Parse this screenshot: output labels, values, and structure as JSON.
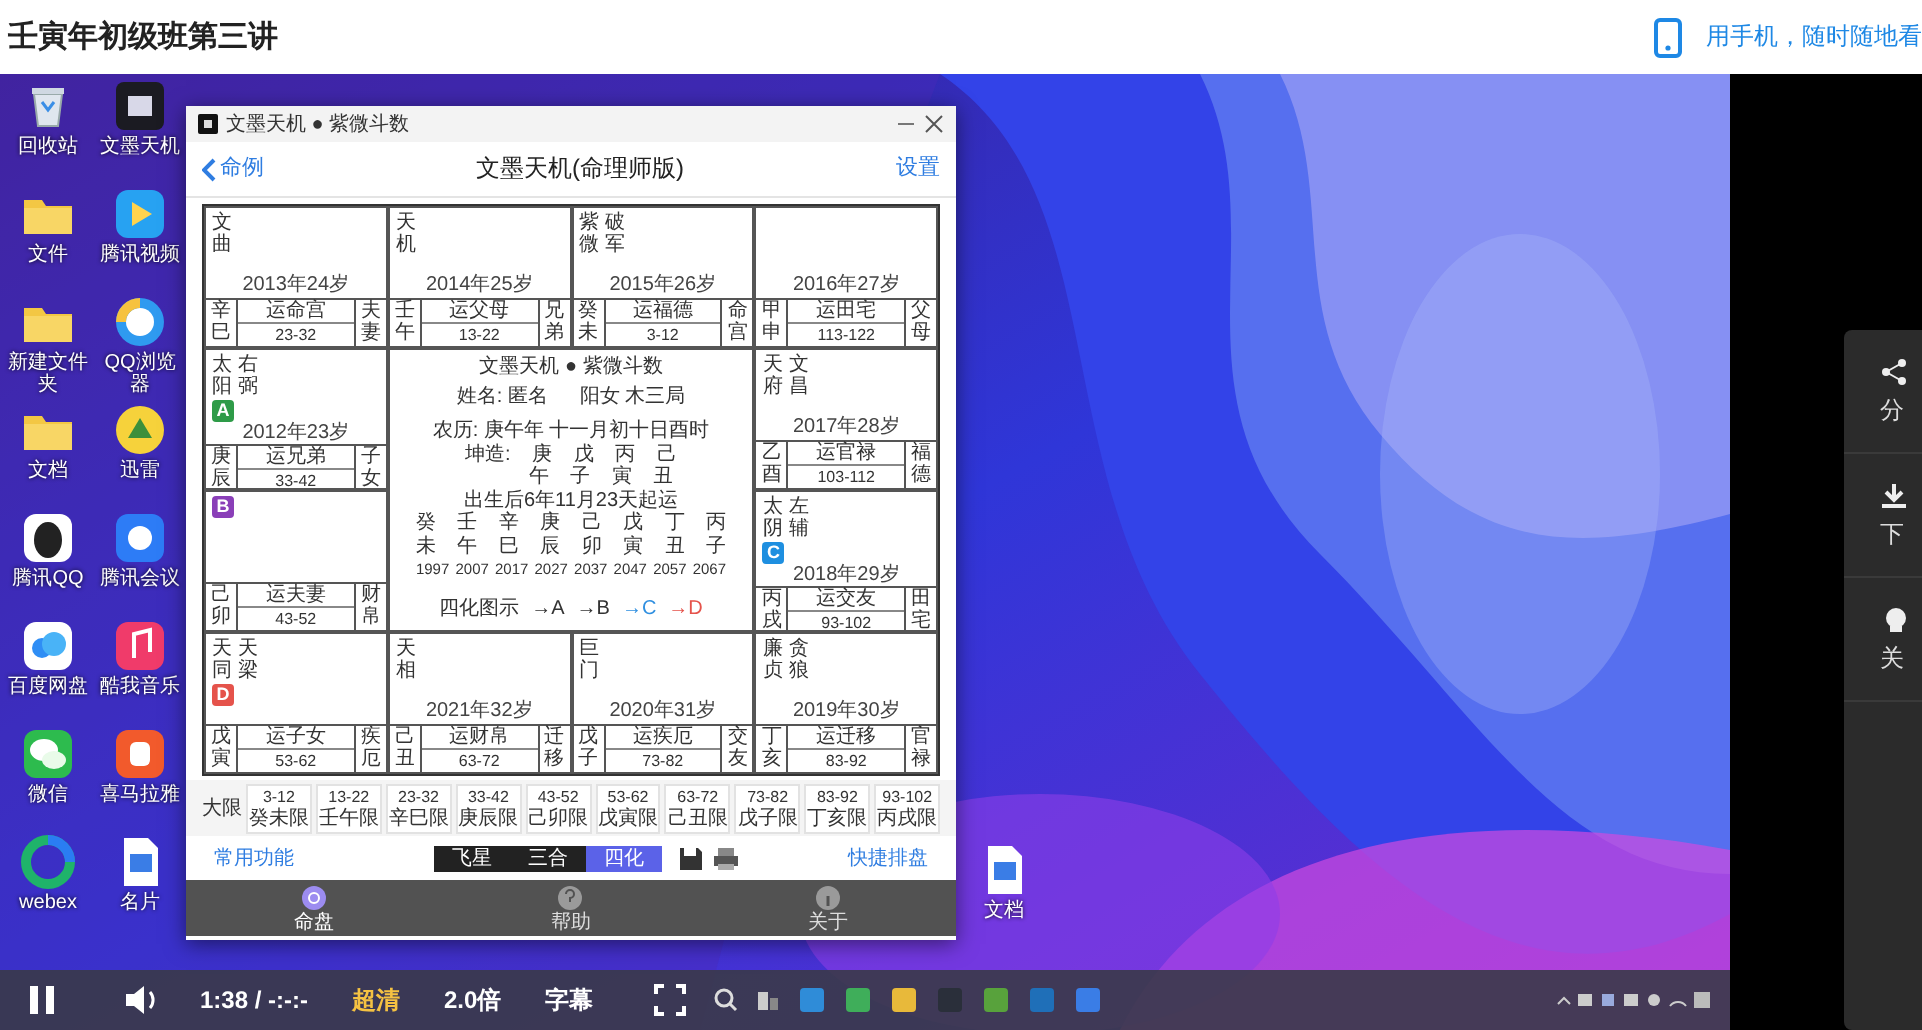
{
  "page": {
    "title": "壬寅年初级班第三讲",
    "mobile_link": "用手机，随时随地看"
  },
  "desktop": {
    "icons": [
      {
        "label": "回收站",
        "kind": "recycle"
      },
      {
        "label": "文墨天机",
        "kind": "app"
      },
      {
        "label": "文件",
        "kind": "folder"
      },
      {
        "label": "腾讯视频",
        "kind": "play"
      },
      {
        "label": "新建文件夹",
        "kind": "folder"
      },
      {
        "label": "QQ浏览器",
        "kind": "browser"
      },
      {
        "label": "文档",
        "kind": "folder"
      },
      {
        "label": "迅雷",
        "kind": "bird"
      },
      {
        "label": "腾讯QQ",
        "kind": "penguin"
      },
      {
        "label": "腾讯会议",
        "kind": "meeting"
      },
      {
        "label": "百度网盘",
        "kind": "cloud"
      },
      {
        "label": "酷我音乐",
        "kind": "music"
      },
      {
        "label": "微信",
        "kind": "chat"
      },
      {
        "label": "喜马拉雅",
        "kind": "audio"
      },
      {
        "label": "webex",
        "kind": "webex"
      },
      {
        "label": "名片",
        "kind": "doc"
      }
    ],
    "file": {
      "label": "文档",
      "kind": "doc"
    }
  },
  "app": {
    "window_title": "文墨天机 ● 紫微斗数",
    "back": "命例",
    "title": "文墨天机(命理师版)",
    "settings": "设置",
    "chart": {
      "palaces": [
        {
          "stars": [
            "文曲"
          ],
          "age": "2013年24岁",
          "stem_branch": "辛巳",
          "decade_palace": "运命宫",
          "range": "23-32",
          "palace": "夫妻"
        },
        {
          "stars": [
            "天机"
          ],
          "age": "2014年25岁",
          "stem_branch": "壬午",
          "decade_palace": "运父母",
          "range": "13-22",
          "palace": "兄弟"
        },
        {
          "stars": [
            "紫微",
            "破军"
          ],
          "age": "2015年26岁",
          "stem_branch": "癸未",
          "decade_palace": "运福德",
          "range": "3-12",
          "palace": "命宫"
        },
        {
          "age": "2016年27岁",
          "stem_branch": "甲申",
          "decade_palace": "运田宅",
          "range": "113-122",
          "palace": "父母"
        },
        {
          "stars": [
            "太阳",
            "右弼"
          ],
          "badge": {
            "label": "A",
            "color": "#2e9b48"
          },
          "age": "2012年23岁",
          "stem_branch": "庚辰",
          "decade_palace": "运兄弟",
          "range": "33-42",
          "palace": "子女"
        },
        {
          "stars": [
            "天府",
            "文昌"
          ],
          "age": "2017年28岁",
          "stem_branch": "乙酉",
          "decade_palace": "运官禄",
          "range": "103-112",
          "palace": "福德"
        },
        {
          "badge": {
            "label": "B",
            "color": "#8a3fb8"
          },
          "stem_branch": "己卯",
          "decade_palace": "运夫妻",
          "range": "43-52",
          "palace": "财帛"
        },
        {
          "stars": [
            "太阴",
            "左辅"
          ],
          "badge": {
            "label": "C",
            "color": "#1e8fe0"
          },
          "age": "2018年29岁",
          "stem_branch": "丙戌",
          "decade_palace": "运交友",
          "range": "93-102",
          "palace": "田宅"
        },
        {
          "stars": [
            "天同",
            "天梁"
          ],
          "badge": {
            "label": "D",
            "color": "#e5534b"
          },
          "stem_branch": "戊寅",
          "decade_palace": "运子女",
          "range": "53-62",
          "palace": "疾厄"
        },
        {
          "stars": [
            "天相"
          ],
          "age": "2021年32岁",
          "stem_branch": "己丑",
          "decade_palace": "运财帛",
          "range": "63-72",
          "palace": "迁移"
        },
        {
          "stars": [
            "巨门"
          ],
          "age": "2020年31岁",
          "stem_branch": "戊子",
          "decade_palace": "运疾厄",
          "range": "73-82",
          "palace": "交友"
        },
        {
          "stars": [
            "廉贞",
            "贪狼"
          ],
          "age": "2019年30岁",
          "stem_branch": "丁亥",
          "decade_palace": "运迁移",
          "range": "83-92",
          "palace": "官禄"
        }
      ],
      "center": {
        "title": "文墨天机 ● 紫微斗数",
        "name": "姓名: 匿名",
        "gender": "阳女 木三局",
        "lunar": "农历: 庚午年 十一月初十日酉时",
        "pillars": [
          "坤造: 庚 戊 丙 己",
          "午 子 寅 丑"
        ],
        "qiyun": "出生后6年11月23天起运",
        "stems": "癸 壬 辛 庚 己 戊 丁 丙",
        "branches": "未 午 巳 辰 卯 寅 丑 子",
        "years": "1997 2007 2017 2027 2037 2047 2057 2067",
        "legend": {
          "label": "四化图示",
          "items": [
            {
              "text": "→A",
              "color": "#333333"
            },
            {
              "text": "→B",
              "color": "#333333"
            },
            {
              "text": "→C",
              "color": "#2f8fe0"
            },
            {
              "text": "→D",
              "color": "#e5534b"
            }
          ]
        }
      }
    },
    "decades_label": "大限",
    "decades": [
      {
        "range": "3-12",
        "name": "癸未限"
      },
      {
        "range": "13-22",
        "name": "壬午限"
      },
      {
        "range": "23-32",
        "name": "辛巳限"
      },
      {
        "range": "33-42",
        "name": "庚辰限"
      },
      {
        "range": "43-52",
        "name": "己卯限"
      },
      {
        "range": "53-62",
        "name": "戊寅限"
      },
      {
        "range": "63-72",
        "name": "己丑限"
      },
      {
        "range": "73-82",
        "name": "戊子限"
      },
      {
        "range": "83-92",
        "name": "丁亥限"
      },
      {
        "range": "93-102",
        "name": "丙戌限"
      }
    ],
    "functions": "常用功能",
    "modes": [
      {
        "label": "飞星",
        "selected": false
      },
      {
        "label": "三合",
        "selected": false
      },
      {
        "label": "四化",
        "selected": true
      }
    ],
    "quick": "快捷排盘",
    "nav": [
      {
        "label": "命盘",
        "kind": "chart",
        "selected": true
      },
      {
        "label": "帮助",
        "kind": "help",
        "selected": false
      },
      {
        "label": "关于",
        "kind": "info",
        "selected": false
      }
    ]
  },
  "player": {
    "playing": true,
    "time": "1:38 / -:-:-",
    "quality": "超清",
    "speed": "2.0倍",
    "subtitles": "字幕"
  },
  "side_panel": [
    {
      "kind": "share",
      "label": "分"
    },
    {
      "kind": "download",
      "label": "下"
    },
    {
      "kind": "light",
      "label": "关"
    }
  ]
}
